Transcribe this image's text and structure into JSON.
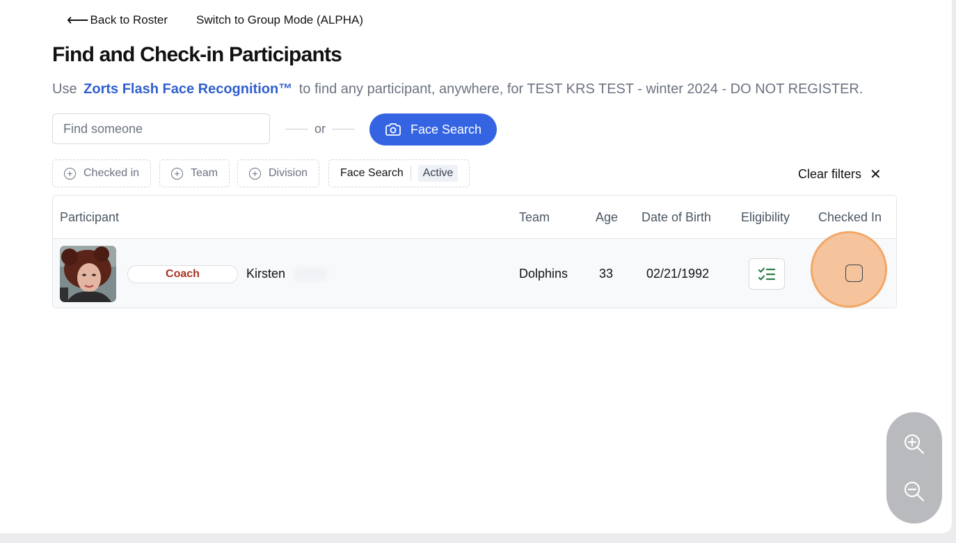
{
  "nav": {
    "back_label": "Back to Roster",
    "group_mode_label": "Switch to Group Mode (ALPHA)"
  },
  "page": {
    "title": "Find and Check-in Participants",
    "subtitle_prefix": "Use",
    "brand_name": "Zorts Flash Face Recognition™",
    "subtitle_suffix": "to find any participant, anywhere, for TEST KRS TEST - winter 2024 - DO NOT REGISTER."
  },
  "search": {
    "placeholder": "Find someone",
    "or_label": "or",
    "face_search_label": "Face Search"
  },
  "filters": {
    "chips": [
      {
        "label": "Checked in"
      },
      {
        "label": "Team"
      },
      {
        "label": "Division"
      }
    ],
    "face_search_chip": {
      "label": "Face Search",
      "value": "Active"
    },
    "clear_label": "Clear filters"
  },
  "table": {
    "columns": {
      "participant": "Participant",
      "team": "Team",
      "age": "Age",
      "dob": "Date of Birth",
      "eligibility": "Eligibility",
      "checked_in": "Checked In"
    },
    "rows": [
      {
        "role": "Coach",
        "name": "Kirsten",
        "team": "Dolphins",
        "age": "33",
        "dob": "02/21/1992",
        "checked_in": false
      }
    ]
  },
  "colors": {
    "accent": "#3564e3",
    "brand_text": "#2f5fce",
    "coach_badge": "#a93224",
    "eligibility_icon": "#2f7d4a",
    "highlight": "#f2a766"
  },
  "icons": {
    "back": "arrow-left-icon",
    "face_search": "camera-icon",
    "filter_add": "plus-circle-icon",
    "clear": "close-icon",
    "eligibility": "checklist-icon",
    "zoom_in": "zoom-in-icon",
    "zoom_out": "zoom-out-icon"
  }
}
